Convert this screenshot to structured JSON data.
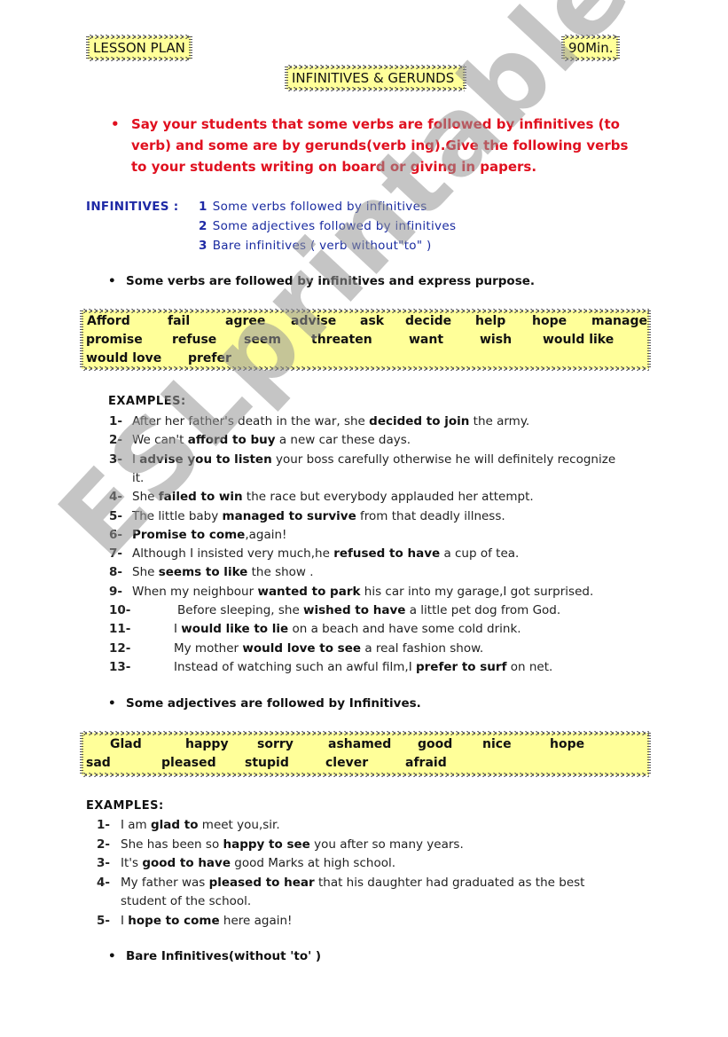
{
  "header": {
    "lesson_plan": "LESSON PLAN",
    "duration": "90Min.",
    "title": "INFINITIVES & GERUNDS"
  },
  "intro": {
    "bullet": "•",
    "text": "Say your students that some verbs are followed by infinitives (to verb) and some are by gerunds(verb ing).Give the following verbs to your students writing on board or giving in papers."
  },
  "infinitives": {
    "label": "INFINITIVES :",
    "items": [
      {
        "num": "1",
        "text": "Some verbs followed by infinitives"
      },
      {
        "num": "2",
        "text": "Some adjectives followed by infinitives"
      },
      {
        "num": "3",
        "text": "Bare infinitives ( verb without\"to\" )"
      }
    ]
  },
  "section1": {
    "bullet": "•",
    "heading": "Some verbs are followed by infinitives and express purpose.",
    "words": [
      "Afford",
      "fail",
      "agree",
      "advise",
      "ask",
      "decide",
      "help",
      "hope",
      "manage",
      "promise",
      "refuse",
      "seem",
      "threaten",
      "want",
      "wish",
      "would like",
      "would love",
      "prefer"
    ],
    "examples_heading": "EXAMPLES:",
    "examples": [
      {
        "n": "1-",
        "pre": "After her father's death in the war, she ",
        "bold": "decided to join",
        "post": " the army."
      },
      {
        "n": "2-",
        "pre": "We can't ",
        "bold": "afford to buy",
        "post": " a new car these days."
      },
      {
        "n": "3-",
        "pre": "I ",
        "bold": "advise you to listen",
        "post": " your boss carefully otherwise he will definitely recognize"
      },
      {
        "n": "",
        "pre": "it.",
        "bold": "",
        "post": ""
      },
      {
        "n": "4-",
        "pre": "She ",
        "bold": "failed to win",
        "post": " the race but everybody applauded her attempt."
      },
      {
        "n": "5-",
        "pre": "The little baby ",
        "bold": "managed to survive",
        "post": " from that deadly illness."
      },
      {
        "n": "6-",
        "pre": "",
        "bold": "Promise to come",
        "post": ",again!"
      },
      {
        "n": "7-",
        "pre": "Although I insisted very much,he ",
        "bold": "refused to have",
        "post": " a cup of tea."
      },
      {
        "n": "8-",
        "pre": "She ",
        "bold": "seems to like",
        "post": " the show ."
      },
      {
        "n": "9-",
        "pre": "When my neighbour ",
        "bold": "wanted to park",
        "post": " his car into my garage,I got surprised."
      },
      {
        "n": "10-",
        "pre": "Before sleeping, she ",
        "bold": "wished to have",
        "post": " a little pet dog from God."
      },
      {
        "n": "11-",
        "pre": "I ",
        "bold": "would like to lie",
        "post": " on a beach and have some cold drink."
      },
      {
        "n": "12-",
        "pre": "My mother ",
        "bold": "would love to see",
        "post": " a real fashion show."
      },
      {
        "n": "13-",
        "pre": "Instead of watching such an awful film,I ",
        "bold": "prefer to surf",
        "post": " on net."
      }
    ]
  },
  "section2": {
    "bullet": "•",
    "heading": "Some adjectives are followed by Infinitives.",
    "words": [
      "Glad",
      "happy",
      "sorry",
      "ashamed",
      "good",
      "nice",
      "hope",
      "sad",
      "pleased",
      "stupid",
      "clever",
      "afraid"
    ],
    "examples_heading": "EXAMPLES:",
    "examples": [
      {
        "n": "1-",
        "pre": "I am ",
        "bold": "glad to",
        "post": " meet you,sir."
      },
      {
        "n": "2-",
        "pre": "She has been so ",
        "bold": "happy to see",
        "post": " you after so many years."
      },
      {
        "n": "3-",
        "pre": "It's ",
        "bold": "good to have",
        "post": " good Marks at high school."
      },
      {
        "n": "4-",
        "pre": "My father was ",
        "bold": "pleased to hear",
        "post": " that his daughter had graduated as the best"
      },
      {
        "n": "",
        "pre": "student of the school.",
        "bold": "",
        "post": ""
      },
      {
        "n": "5-",
        "pre": "I ",
        "bold": "hope to come",
        "post": " here again!"
      }
    ]
  },
  "section3": {
    "bullet": "•",
    "heading": "Bare Infinitives(without 'to' )"
  },
  "watermark": "ESLprintables.com"
}
